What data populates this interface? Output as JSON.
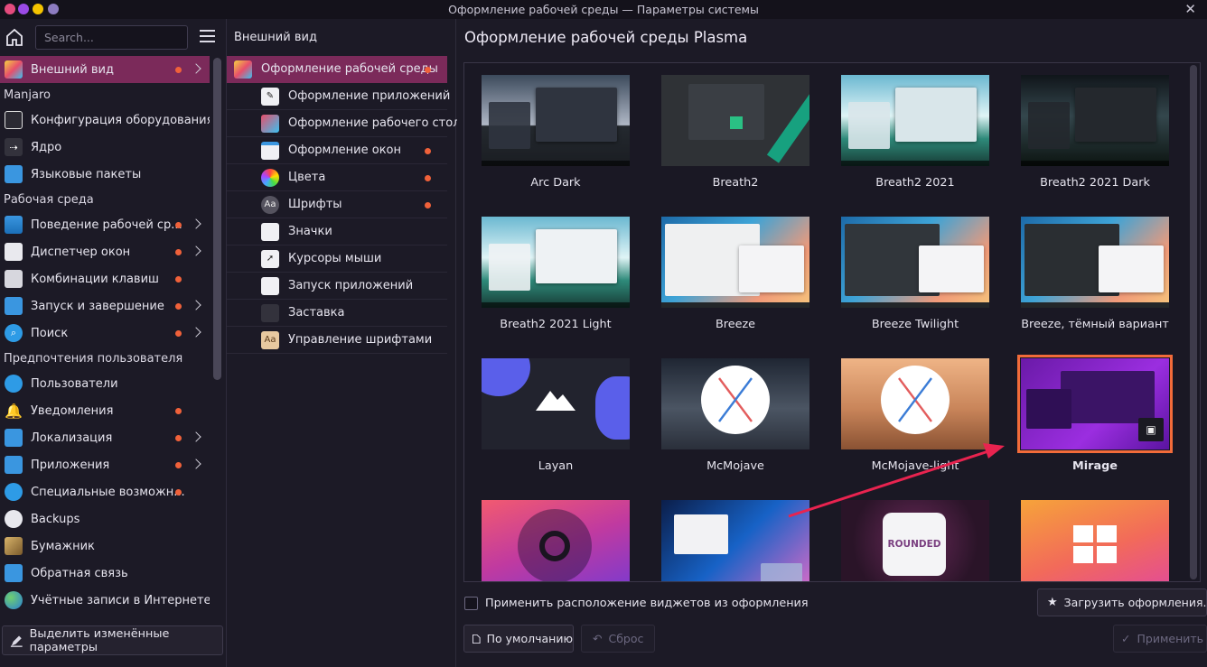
{
  "window": {
    "title": "Оформление рабочей среды — Параметры системы",
    "dot_colors": [
      "#e54b7d",
      "#9b4ae6",
      "#f5c400",
      "#8d7cc0"
    ]
  },
  "sidebar": {
    "search_placeholder": "Search...",
    "groups": [
      {
        "type": "item",
        "label": "Внешний вид",
        "icon": "appearance-icon",
        "dot": true,
        "chevron": true,
        "active": true
      },
      {
        "type": "category",
        "label": "Manjaro"
      },
      {
        "type": "item",
        "label": "Конфигурация оборудования",
        "icon": "hardware-icon",
        "dot": false,
        "chevron": false
      },
      {
        "type": "item",
        "label": "Ядро",
        "icon": "kernel-icon",
        "dot": false,
        "chevron": false
      },
      {
        "type": "item",
        "label": "Языковые пакеты",
        "icon": "language-packages-icon",
        "dot": false,
        "chevron": false
      },
      {
        "type": "category",
        "label": "Рабочая среда"
      },
      {
        "type": "item",
        "label": "Поведение рабочей ср...",
        "icon": "workspace-behavior-icon",
        "dot": true,
        "chevron": true
      },
      {
        "type": "item",
        "label": "Диспетчер окон",
        "icon": "window-manager-icon",
        "dot": true,
        "chevron": true
      },
      {
        "type": "item",
        "label": "Комбинации клавиш",
        "icon": "keyboard-icon",
        "dot": true,
        "chevron": false
      },
      {
        "type": "item",
        "label": "Запуск и завершение",
        "icon": "startup-icon",
        "dot": true,
        "chevron": true
      },
      {
        "type": "item",
        "label": "Поиск",
        "icon": "search-icon",
        "dot": true,
        "chevron": true
      },
      {
        "type": "category",
        "label": "Предпочтения пользователя"
      },
      {
        "type": "item",
        "label": "Пользователи",
        "icon": "users-icon",
        "dot": false,
        "chevron": false
      },
      {
        "type": "item",
        "label": "Уведомления",
        "icon": "bell-icon",
        "dot": true,
        "chevron": false
      },
      {
        "type": "item",
        "label": "Локализация",
        "icon": "localization-icon",
        "dot": true,
        "chevron": true
      },
      {
        "type": "item",
        "label": "Приложения",
        "icon": "applications-icon",
        "dot": true,
        "chevron": true
      },
      {
        "type": "item",
        "label": "Специальные возможн...",
        "icon": "accessibility-icon",
        "dot": true,
        "chevron": false
      },
      {
        "type": "item",
        "label": "Backups",
        "icon": "backups-icon",
        "dot": false,
        "chevron": false
      },
      {
        "type": "item",
        "label": "Бумажник",
        "icon": "wallet-icon",
        "dot": false,
        "chevron": false
      },
      {
        "type": "item",
        "label": "Обратная связь",
        "icon": "feedback-icon",
        "dot": false,
        "chevron": false
      },
      {
        "type": "item",
        "label": "Учётные записи в Интернете",
        "icon": "globe-icon",
        "dot": false,
        "chevron": false
      }
    ],
    "highlight_button": "Выделить изменённые параметры"
  },
  "midcol": {
    "header": "Внешний вид",
    "items": [
      {
        "label": "Оформление рабочей среды",
        "icon": "global-theme-icon",
        "dot": true,
        "active": true,
        "root": true
      },
      {
        "label": "Оформление приложений",
        "icon": "app-style-icon",
        "dot": false
      },
      {
        "label": "Оформление рабочего стола",
        "icon": "plasma-style-icon",
        "dot": false
      },
      {
        "label": "Оформление окон",
        "icon": "window-decorations-icon",
        "dot": true
      },
      {
        "label": "Цвета",
        "icon": "colors-icon",
        "dot": true
      },
      {
        "label": "Шрифты",
        "icon": "fonts-icon",
        "dot": true
      },
      {
        "label": "Значки",
        "icon": "icons-icon",
        "dot": false
      },
      {
        "label": "Курсоры мыши",
        "icon": "cursors-icon",
        "dot": false
      },
      {
        "label": "Запуск приложений",
        "icon": "launch-feedback-icon",
        "dot": false
      },
      {
        "label": "Заставка",
        "icon": "splash-screen-icon",
        "dot": false
      },
      {
        "label": "Управление шрифтами",
        "icon": "font-management-icon",
        "dot": false
      }
    ]
  },
  "main": {
    "title": "Оформление рабочей среды Plasma",
    "themes": [
      {
        "name": "Arc Dark",
        "style": "arcdark"
      },
      {
        "name": "Breath2",
        "style": "breath2"
      },
      {
        "name": "Breath2 2021",
        "style": "breath2021"
      },
      {
        "name": "Breath2 2021 Dark",
        "style": "breath2021dark"
      },
      {
        "name": "Breath2 2021 Light",
        "style": "breath2021light"
      },
      {
        "name": "Breeze",
        "style": "breeze"
      },
      {
        "name": "Breeze Twilight",
        "style": "breezetwilight"
      },
      {
        "name": "Breeze, тёмный вариант",
        "style": "breezedark"
      },
      {
        "name": "Layan",
        "style": "layan",
        "logo": "mountain-logo"
      },
      {
        "name": "McMojave",
        "style": "mcmojave",
        "logo": "x-logo"
      },
      {
        "name": "McMojave-light",
        "style": "mcmojavelight",
        "logo": "x-logo"
      },
      {
        "name": "Mirage",
        "style": "mirage",
        "selected": true
      },
      {
        "name": "",
        "style": "ring"
      },
      {
        "name": "",
        "style": "bluewave"
      },
      {
        "name": "",
        "style": "rounded",
        "logo_text": "ROUNDED"
      },
      {
        "name": "",
        "style": "windows"
      }
    ],
    "widget_layout_label": "Применить расположение виджетов из оформления",
    "load_button": "Загрузить оформления...",
    "default_button": "По умолчанию",
    "reset_button": "Сброс",
    "apply_button": "Применить",
    "accent_color": "#7b2a5a",
    "selection_color": "#f26b3a",
    "arrow_color": "#e8234f"
  }
}
